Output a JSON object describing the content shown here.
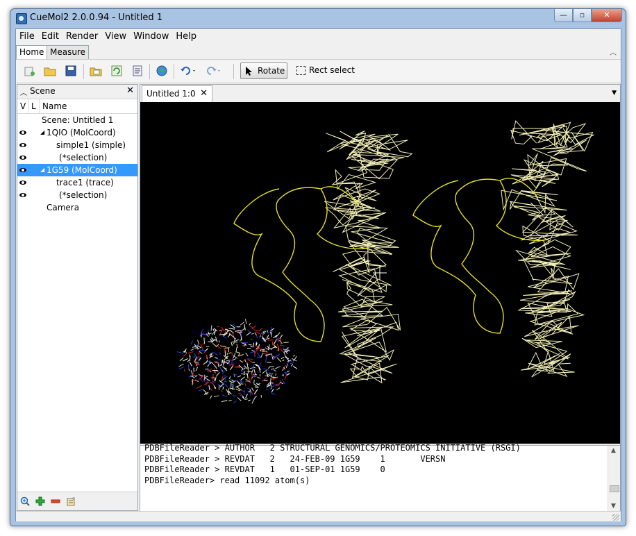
{
  "window": {
    "title": "CueMol2 2.0.0.94 - Untitled 1",
    "min_icon": "minimize-icon",
    "max_icon": "maximize-icon",
    "close_icon": "close-icon"
  },
  "menu": [
    {
      "label": "File"
    },
    {
      "label": "Edit"
    },
    {
      "label": "Render"
    },
    {
      "label": "View"
    },
    {
      "label": "Window"
    },
    {
      "label": "Help"
    }
  ],
  "ribbon_tabs": [
    {
      "label": "Home"
    },
    {
      "label": "Measure"
    }
  ],
  "toolbar": {
    "rotate_label": "Rotate",
    "rect_select_label": "Rect select",
    "buttons": [
      "new-icon",
      "open-icon",
      "save-icon",
      "open-file-icon",
      "reload-icon",
      "properties-icon",
      "globe-icon",
      "undo-icon",
      "redo-icon"
    ]
  },
  "scene_panel": {
    "title": "Scene",
    "columns": [
      "V",
      "L",
      "Name"
    ],
    "items": [
      {
        "label": "Scene: Untitled 1",
        "indent": 0,
        "visible": false,
        "expander": ""
      },
      {
        "label": "1QIO (MolCoord)",
        "indent": 1,
        "visible": true,
        "expander": "◢"
      },
      {
        "label": "simple1 (simple)",
        "indent": 2,
        "visible": true,
        "expander": ""
      },
      {
        "label": "(*selection)",
        "indent": 3,
        "visible": true,
        "expander": ""
      },
      {
        "label": "1G59 (MolCoord)",
        "indent": 1,
        "visible": true,
        "expander": "◢",
        "selected": true
      },
      {
        "label": "trace1 (trace)",
        "indent": 2,
        "visible": true,
        "expander": ""
      },
      {
        "label": "(*selection)",
        "indent": 3,
        "visible": true,
        "expander": ""
      },
      {
        "label": "Camera",
        "indent": 1,
        "visible": false,
        "expander": ""
      }
    ],
    "footer_buttons": [
      "zoom-icon",
      "add-icon",
      "remove-icon",
      "properties-icon"
    ]
  },
  "document": {
    "tab_label": "Untitled 1:0",
    "console_lines": [
      "PDBFileReader > AUTHOR   2 STRUCTURAL GENOMICS/PROTEOMICS INITIATIVE (RSGI)",
      "PDBFileReader > REVDAT   2   24-FEB-09 1G59    1       VERSN",
      "PDBFileReader > REVDAT   1   01-SEP-01 1G59    0",
      "PDBFileReader> read 11092 atom(s)"
    ]
  },
  "colors": {
    "trace": "#f2efb6",
    "ribbon": "#e6dd22",
    "viewport_bg": "#000000",
    "selection": "#3399ff"
  }
}
